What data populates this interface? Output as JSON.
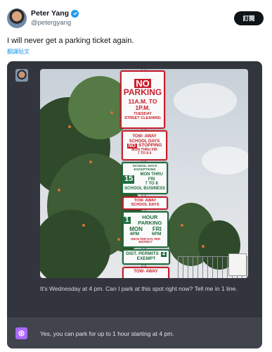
{
  "author": {
    "name": "Peter Yang",
    "handle": "@petergyang",
    "subscribe_label": "訂閱"
  },
  "tweet": {
    "text": "I will never get a parking ticket again.",
    "translate_link": "翻譯貼文"
  },
  "photo": {
    "signs": {
      "no_parking": {
        "no": "NO",
        "parking": "PARKING",
        "hours": "11A.M. TO 1P.M.",
        "day": "TUESDAY",
        "note": "STREET CLEANING"
      },
      "tow_away_1": {
        "tow": "TOW- AWAY",
        "school": "SCHOOL DAYS",
        "no": "NO",
        "stopping": "STOPPING",
        "days": "MON THRU FRI",
        "time": "7 TO 8 4"
      },
      "exceptions": {
        "head": "SCHOOL DAYS EXCEPTIONS",
        "minutes": "15",
        "days": "MON THRU FRI",
        "time": "7 TO 8",
        "note": "SCHOOL BUSINESS"
      },
      "tow_away_2": {
        "tow": "TOW- AWAY",
        "school": "SCHOOL DAYS"
      },
      "hour_parking": {
        "num": "1",
        "label": "HOUR PARKING",
        "days_a": "MON",
        "days_b": "FRI",
        "time_a": "4PM",
        "time_b": "6PM",
        "note": "ONCE PER DAY, PER DISTRICT"
      },
      "permits": {
        "line1": "DIST. PERMITS",
        "num": "4",
        "line2": "EXEMPT"
      },
      "tow_away_3": {
        "tow": "TOW- AWAY"
      }
    }
  },
  "chat": {
    "question": "It's Wednesday at 4 pm. Can I park at this spot right now? Tell me in 1 line.",
    "answer": "Yes, you can park for up to 1 hour starting at 4 pm."
  },
  "colors": {
    "accent": "#1d9bf0",
    "panel": "#33353e",
    "answer_bar": "#41434d",
    "gpt_icon": "#ab68ff",
    "sign_red": "#c8202e",
    "sign_green": "#1f6d3e"
  },
  "icons": {
    "verified": "verified-badge-icon",
    "assistant": "chatgpt-logo-icon"
  }
}
